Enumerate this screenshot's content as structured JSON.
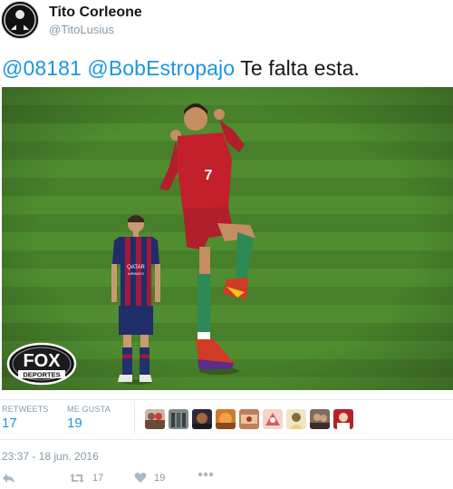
{
  "user": {
    "display_name": "Tito Corleone",
    "username": "@TitoLusius"
  },
  "tweet": {
    "mention_1": "@08181",
    "mention_2": "@BobEstropajo",
    "text": "Te falta esta."
  },
  "media": {
    "logo_text_top": "FOX",
    "logo_text_bottom": "DEPORTES",
    "left_player_sponsor": "QATAR",
    "left_player_sponsor_2": "AIRWAYS",
    "right_player_number": "7"
  },
  "stats": {
    "retweets_label": "RETWEETS",
    "retweets_value": "17",
    "likes_label": "ME GUSTA",
    "likes_value": "19"
  },
  "timestamp": "23:37 - 18 jun. 2016",
  "actions": {
    "retweet_count": "17",
    "like_count": "19"
  },
  "colors": {
    "link": "#1b95e0",
    "muted": "#8899a6",
    "grass": "#4d8a2e"
  },
  "icons": [
    "reply-icon",
    "retweet-icon",
    "heart-icon",
    "more-icon"
  ]
}
